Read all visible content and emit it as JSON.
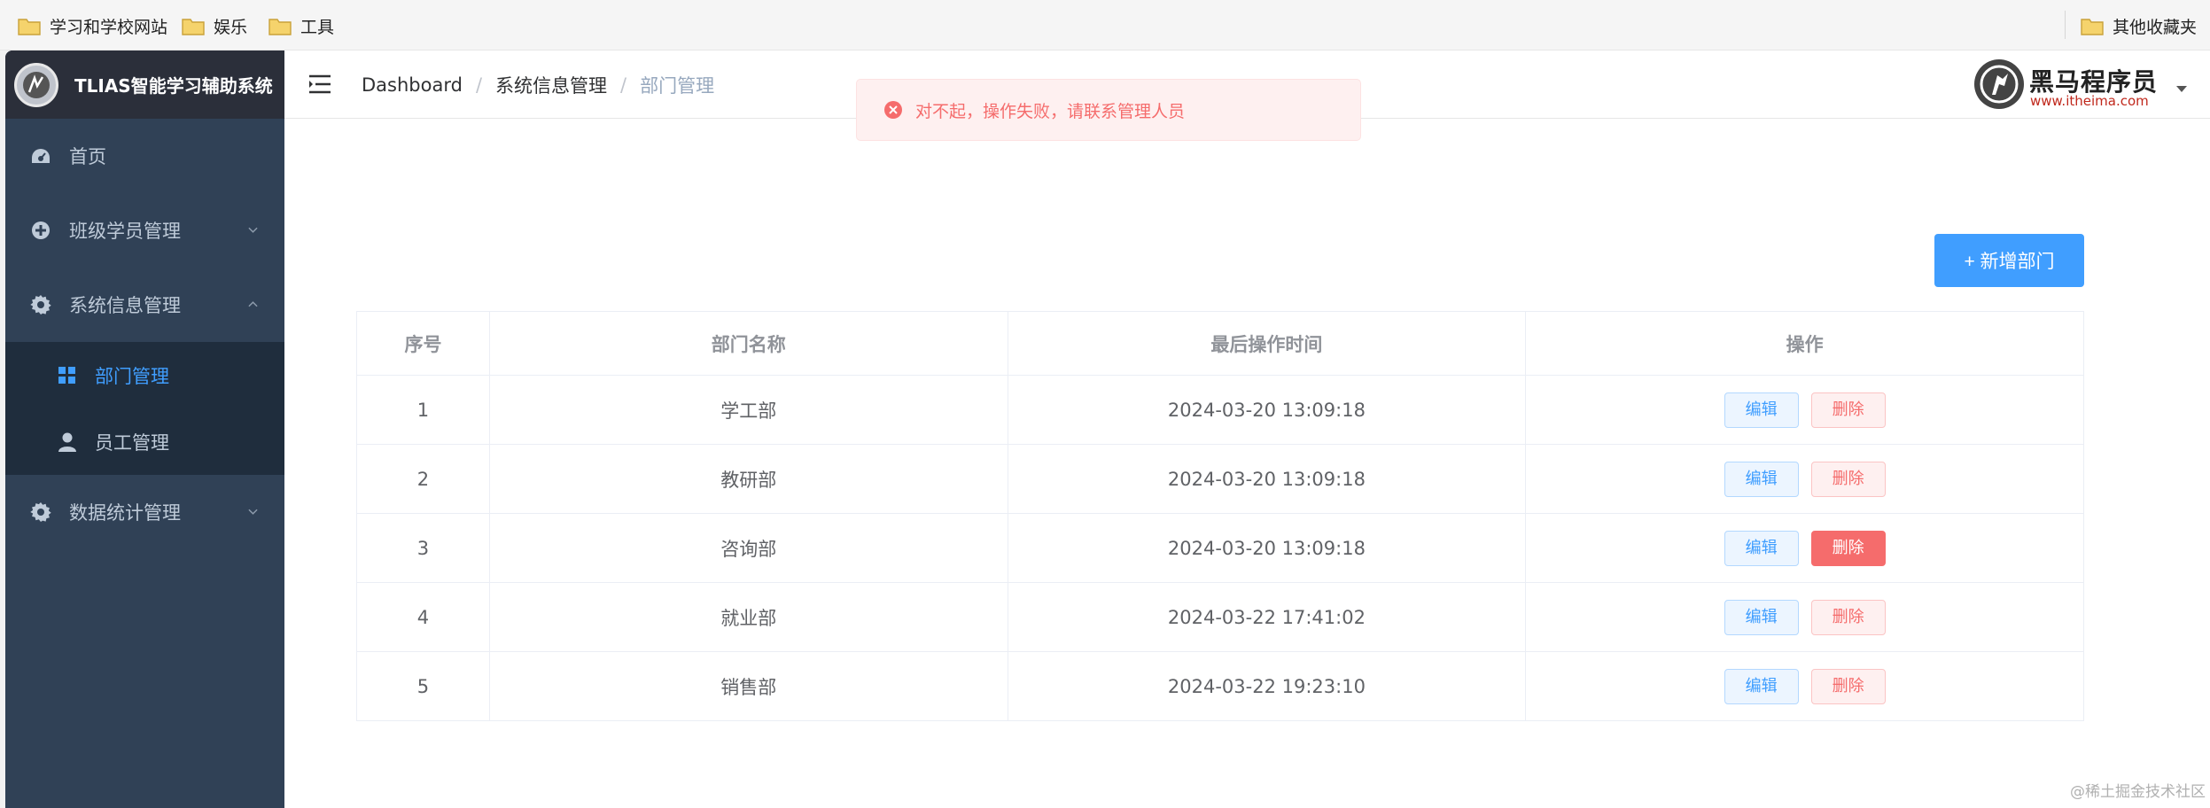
{
  "bookmarks": {
    "items": [
      {
        "label": "学习和学校网站"
      },
      {
        "label": "娱乐"
      },
      {
        "label": "工具"
      }
    ],
    "other": "其他收藏夹"
  },
  "sidebar": {
    "title": "TLIAS智能学习辅助系统",
    "menu": [
      {
        "label": "首页",
        "icon": "dashboard-icon"
      },
      {
        "label": "班级学员管理",
        "icon": "plus-circle-icon"
      },
      {
        "label": "系统信息管理",
        "icon": "gear-icon",
        "expanded": true
      },
      {
        "label": "数据统计管理",
        "icon": "gear-icon"
      }
    ],
    "submenu": [
      {
        "label": "部门管理",
        "icon": "grid-icon",
        "active": true
      },
      {
        "label": "员工管理",
        "icon": "user-icon"
      }
    ]
  },
  "header": {
    "breadcrumb": [
      "Dashboard",
      "系统信息管理",
      "部门管理"
    ],
    "brand_name": "黑马程序员",
    "brand_url": "www.itheima.com"
  },
  "toast": {
    "type": "error",
    "message": "对不起，操作失败，请联系管理人员"
  },
  "toolbar": {
    "add_label": "+ 新增部门"
  },
  "table": {
    "headers": [
      "序号",
      "部门名称",
      "最后操作时间",
      "操作"
    ],
    "edit_label": "编辑",
    "delete_label": "删除",
    "rows": [
      {
        "index": "1",
        "name": "学工部",
        "time": "2024-03-20 13:09:18"
      },
      {
        "index": "2",
        "name": "教研部",
        "time": "2024-03-20 13:09:18"
      },
      {
        "index": "3",
        "name": "咨询部",
        "time": "2024-03-20 13:09:18"
      },
      {
        "index": "4",
        "name": "就业部",
        "time": "2024-03-22 17:41:02"
      },
      {
        "index": "5",
        "name": "销售部",
        "time": "2024-03-22 19:23:10"
      }
    ]
  },
  "watermark": "@稀土掘金技术社区",
  "colors": {
    "sidebar_bg": "#304156",
    "submenu_bg": "#1f2d3d",
    "primary": "#409eff",
    "danger": "#f56c6c"
  }
}
